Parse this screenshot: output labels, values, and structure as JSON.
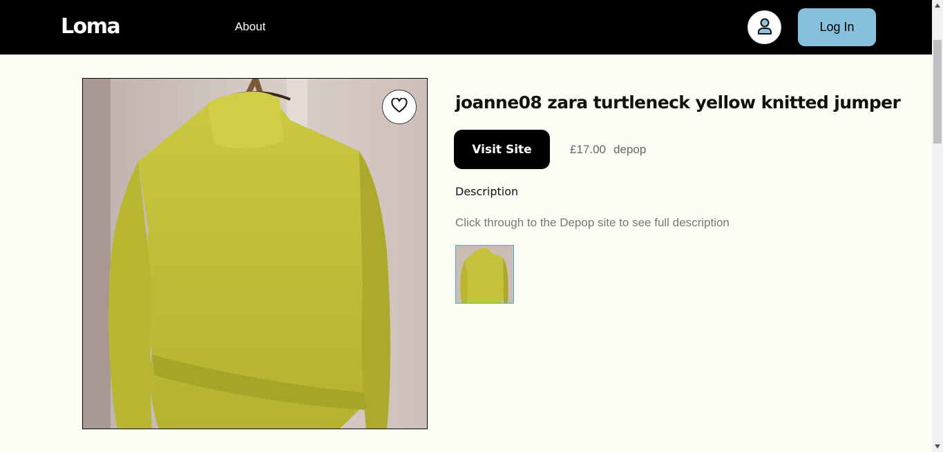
{
  "header": {
    "logo": "Loma",
    "nav_about": "About",
    "login_label": "Log In"
  },
  "product": {
    "title": "joanne08 zara turtleneck yellow knitted jumper",
    "visit_label": "Visit Site",
    "price": "£17.00",
    "source": "depop",
    "description_heading": "Description",
    "description_text": "Click through to the Depop site to see full description"
  },
  "icons": {
    "profile": "user-icon",
    "favorite": "heart-icon"
  },
  "colors": {
    "header_bg": "#000000",
    "login_bg": "#87c0dc",
    "page_bg": "#fdfdf5",
    "thumb_border": "#3fb6b6",
    "jumper": "#c4c23a"
  }
}
